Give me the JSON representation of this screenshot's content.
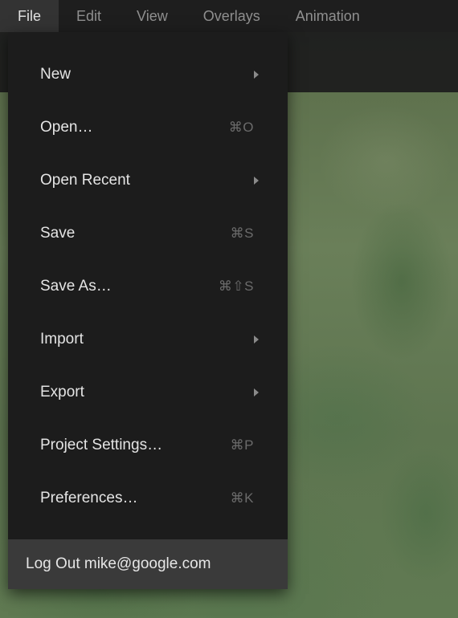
{
  "menubar": {
    "items": [
      {
        "label": "File",
        "active": true
      },
      {
        "label": "Edit",
        "active": false
      },
      {
        "label": "View",
        "active": false
      },
      {
        "label": "Overlays",
        "active": false
      },
      {
        "label": "Animation",
        "active": false
      }
    ]
  },
  "dropdown": {
    "items": [
      {
        "label": "New",
        "shortcut": "",
        "submenu": true
      },
      {
        "label": "Open…",
        "shortcut": "⌘O",
        "submenu": false
      },
      {
        "label": "Open Recent",
        "shortcut": "",
        "submenu": true
      },
      {
        "label": "Save",
        "shortcut": "⌘S",
        "submenu": false
      },
      {
        "label": "Save As…",
        "shortcut": "⌘⇧S",
        "submenu": false
      },
      {
        "label": "Import",
        "shortcut": "",
        "submenu": true
      },
      {
        "label": "Export",
        "shortcut": "",
        "submenu": true
      },
      {
        "label": "Project Settings…",
        "shortcut": "⌘P",
        "submenu": false
      },
      {
        "label": "Preferences…",
        "shortcut": "⌘K",
        "submenu": false
      }
    ],
    "logout_label": "Log Out mike@google.com"
  }
}
